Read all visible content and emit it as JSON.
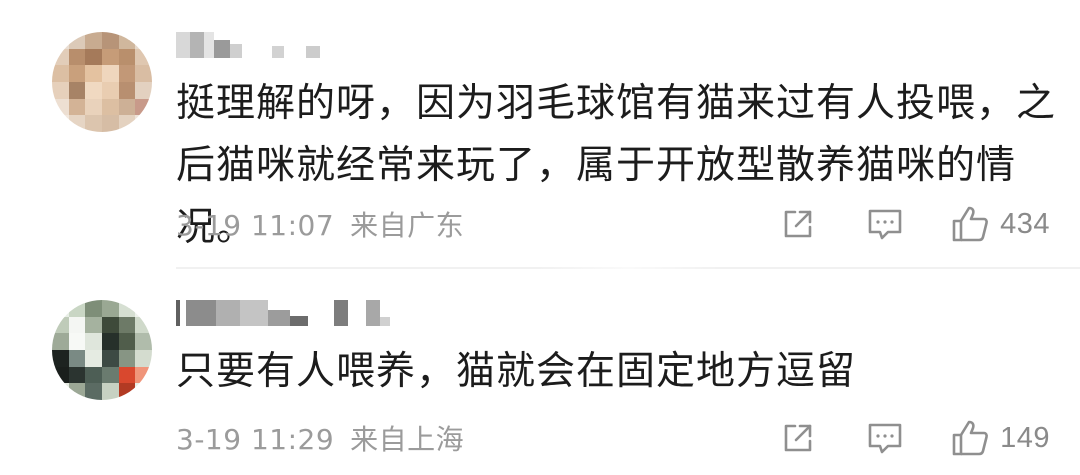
{
  "comments": [
    {
      "text": "挺理解的呀，因为羽毛球馆有猫来过有人投喂，之后猫咪就经常来玩了，属于开放型散养猫咪的情况。",
      "time": "3-19 11:07",
      "location": "来自广东",
      "likes": "434",
      "icons": {
        "share": "share-icon",
        "reply": "comment-icon",
        "like": "thumbs-up-icon"
      }
    },
    {
      "text": "只要有人喂养，猫就会在固定地方逗留",
      "time": "3-19 11:29",
      "location": "来自上海",
      "likes": "149",
      "icons": {
        "share": "share-icon",
        "reply": "comment-icon",
        "like": "thumbs-up-icon"
      }
    }
  ],
  "colors": {
    "text": "#1c1c1c",
    "meta": "#9b9b9b",
    "icon": "#8f8f8f"
  }
}
